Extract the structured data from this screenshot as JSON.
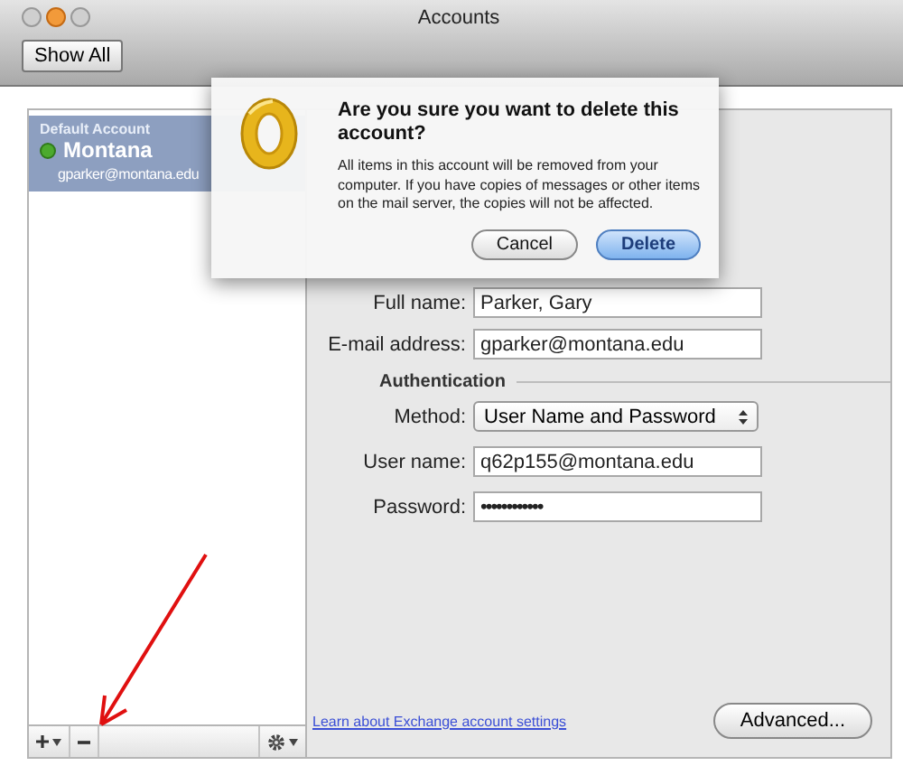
{
  "window": {
    "title": "Accounts"
  },
  "toolbar": {
    "show_all": "Show All"
  },
  "sidebar": {
    "group_label": "Default Account",
    "accounts": [
      {
        "name": "Montana",
        "email": "gparker@montana.edu",
        "selected": true,
        "online": true
      }
    ]
  },
  "form": {
    "fields": [
      {
        "label": "Full name:",
        "value": "Parker, Gary",
        "kind": "text"
      },
      {
        "label": "E-mail address:",
        "value": "gparker@montana.edu",
        "kind": "text"
      }
    ],
    "section": "Authentication",
    "auth_fields": [
      {
        "label": "Method:",
        "value": "User Name and Password",
        "kind": "select"
      },
      {
        "label": "User name:",
        "value": "q62p155@montana.edu",
        "kind": "text"
      },
      {
        "label": "Password:",
        "value": "••••••••••••",
        "kind": "password"
      }
    ],
    "link": "Learn about Exchange account settings",
    "advanced_button": "Advanced..."
  },
  "dialog": {
    "title": "Are you sure you want to delete this account?",
    "message": "All items in this account will be removed from your computer. If you have copies of messages or other items on the mail server, the copies will not be affected.",
    "buttons": [
      {
        "label": "Cancel",
        "default": false
      },
      {
        "label": "Delete",
        "default": true
      }
    ]
  }
}
